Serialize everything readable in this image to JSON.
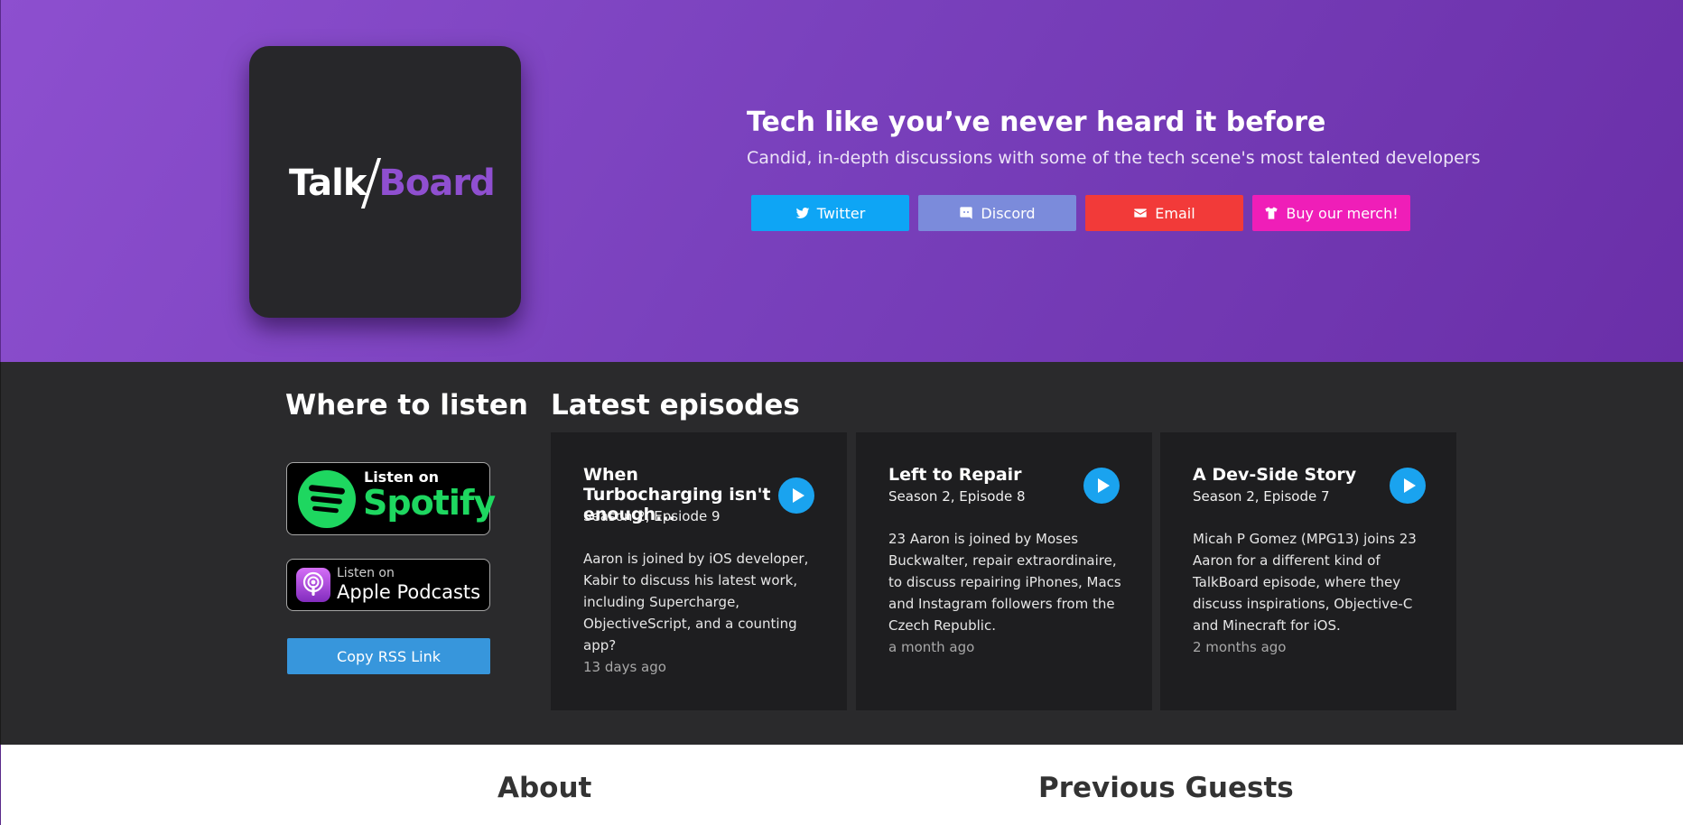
{
  "hero": {
    "logo": {
      "talk": "Talk",
      "board": "Board"
    },
    "title": "Tech like you’ve never heard it before",
    "subtitle": "Candid, in-depth discussions with some of the tech scene's most talented developers",
    "buttons": [
      {
        "label": "Twitter",
        "icon": "twitter-icon",
        "color": "#0ea5f5"
      },
      {
        "label": "Discord",
        "icon": "discord-icon",
        "color": "#7b8bdb"
      },
      {
        "label": "Email",
        "icon": "envelope-icon",
        "color": "#f23a39"
      },
      {
        "label": "Buy our merch!",
        "icon": "tshirt-icon",
        "color": "#ef1eb8"
      }
    ]
  },
  "where": {
    "title": "Where to listen",
    "spotify": {
      "small": "Listen on",
      "big": "Spotify"
    },
    "apple": {
      "small": "Listen on",
      "big": "Apple Podcasts"
    },
    "rss_label": "Copy RSS Link"
  },
  "latest": {
    "title": "Latest episodes",
    "episodes": [
      {
        "title": "When Turbocharging isn't enough...",
        "meta": "Season 2, Epsiode 9",
        "desc": "Aaron is joined by iOS developer, Kabir to discuss his latest work, including Supercharge, ObjectiveScript, and a counting app?",
        "date": "13 days ago"
      },
      {
        "title": "Left to Repair",
        "meta": "Season 2, Episode 8",
        "desc": "23 Aaron is joined by Moses Buckwalter, repair extraordinaire, to discuss repairing iPhones, Macs and Instagram followers from the Czech Republic.",
        "date": "a month ago"
      },
      {
        "title": "A Dev-Side Story",
        "meta": "Season 2, Episode 7",
        "desc": "Micah P Gomez (MPG13) joins 23 Aaron for a different kind of TalkBoard episode, where they discuss inspirations, Objective-C and Minecraft for iOS.",
        "date": "2 months ago"
      }
    ]
  },
  "bottom": {
    "about": "About",
    "guests": "Previous Guests"
  }
}
